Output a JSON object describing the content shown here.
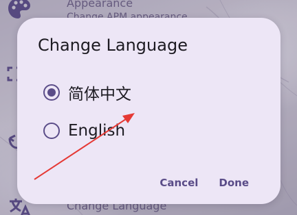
{
  "background": {
    "appearance_title": "Appearance",
    "appearance_subtitle": "Change APM appearance",
    "language_title": "Change Language"
  },
  "dialog": {
    "title": "Change Language",
    "options": [
      {
        "label": "简体中文",
        "selected": true
      },
      {
        "label": "English",
        "selected": false
      }
    ],
    "cancel_label": "Cancel",
    "done_label": "Done"
  },
  "colors": {
    "accent": "#5a4c88",
    "dialog_bg": "#ede6f6",
    "annotation": "#e53935"
  },
  "icons": [
    "palette-icon",
    "language-icon",
    "radio-checked-icon",
    "radio-unchecked-icon",
    "arrow-annotation"
  ]
}
